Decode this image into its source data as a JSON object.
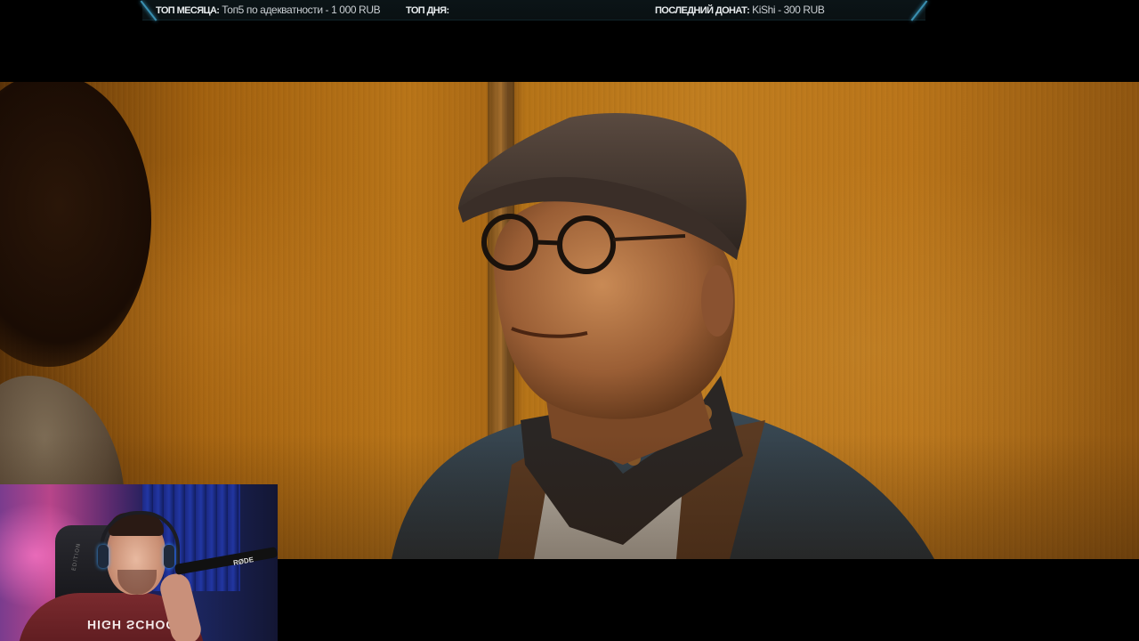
{
  "ticker": {
    "top_month_label": "ТОП МЕСЯЦА:",
    "top_month_value": "Топ5 по адекватности - 1 000 RUB",
    "top_day_label": "ТОП ДНЯ:",
    "top_day_value": "",
    "last_donation_label": "ПОСЛЕДНИЙ ДОНАТ:",
    "last_donation_value": "KiShi - 300 RUB",
    "accent_color": "#3a8fb0"
  },
  "webcam": {
    "mic_brand": "RØDE",
    "shirt_text": "HIGH SCHOOL",
    "chair_text": "EDITION"
  }
}
